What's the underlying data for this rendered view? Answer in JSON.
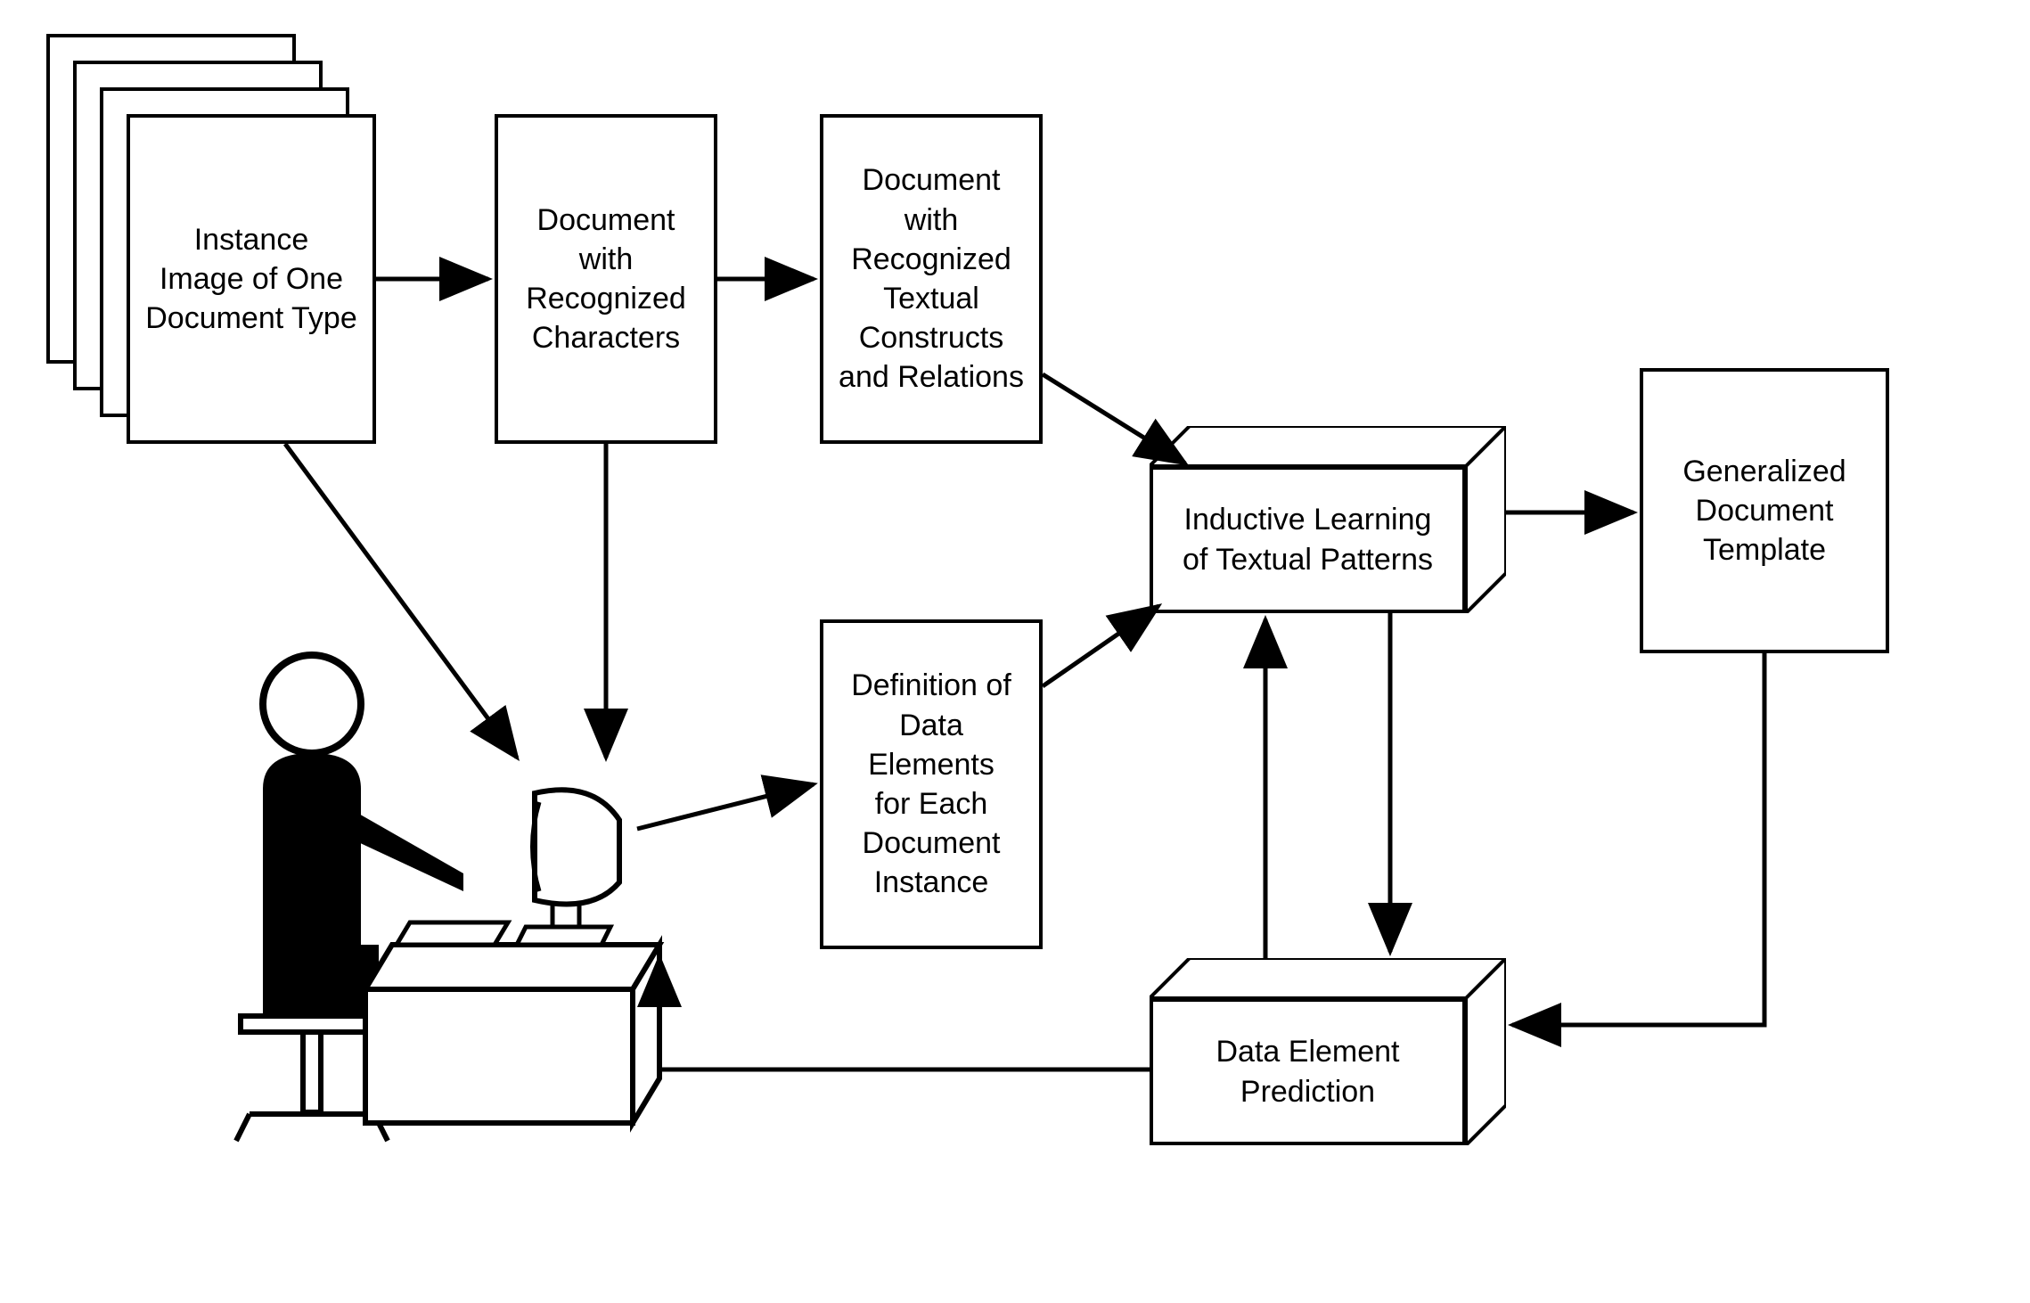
{
  "nodes": {
    "instance_image": "Instance\nImage of One\nDocument Type",
    "doc_recognized_chars": "Document with\nRecognized\nCharacters",
    "doc_recognized_constructs": "Document with\nRecognized\nTextual\nConstructs\nand Relations",
    "definition_data_elements": "Definition of\nData Elements\nfor Each\nDocument\nInstance",
    "inductive_learning": "Inductive Learning\nof Textual Patterns",
    "generalized_template": "Generalized\nDocument\nTemplate",
    "data_element_prediction": "Data Element\nPrediction"
  }
}
